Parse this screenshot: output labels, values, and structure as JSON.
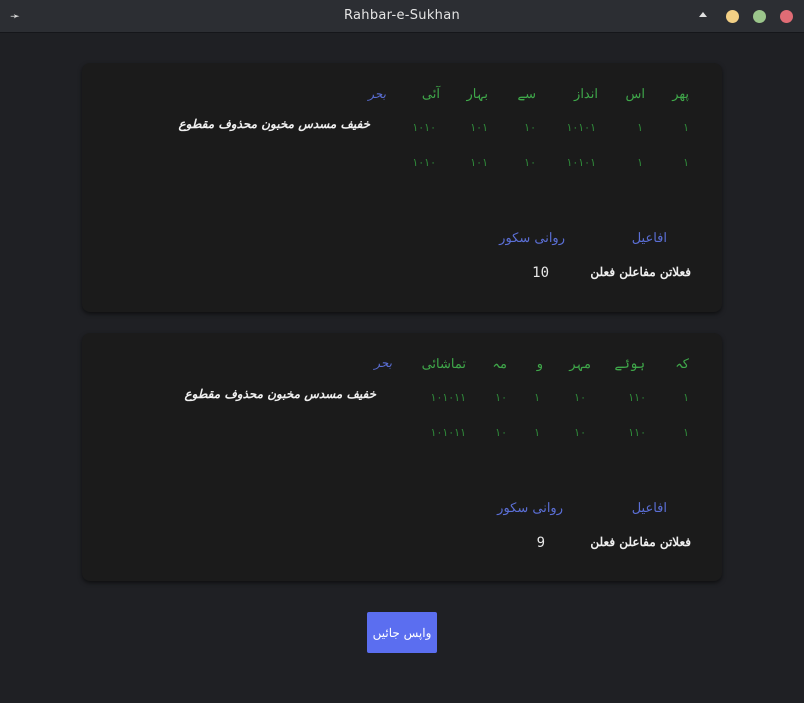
{
  "window": {
    "title": "Rahbar-e-Sukhan"
  },
  "results": [
    {
      "words": [
        "پھر",
        "اس",
        "انداز",
        "سے",
        "بہار",
        "آئی"
      ],
      "weights_row1": [
        "۱",
        "۱",
        "۱۰۱۰۱",
        "۱۰",
        "۱۰۱",
        "۱۰۱۰"
      ],
      "weights_row2": [
        "۱",
        "۱",
        "۱۰۱۰۱",
        "۱۰",
        "۱۰۱",
        "۱۰۱۰"
      ],
      "bahr_label": "بحر",
      "bahr_value": "خفیف مسدس مخبون محذوف مقطوع",
      "afaeel_label": "افاعیل",
      "afaeel_value": "فعلاتن مفاعلن فعلن",
      "score_label": "روانی سکور",
      "score_value": "10"
    },
    {
      "words": [
        "کہ",
        "ہوئے",
        "مہر",
        "و",
        "مہ",
        "تماشائی"
      ],
      "weights_row1": [
        "۱",
        "۱۱۰",
        "۱۰",
        "۱",
        "۱۰",
        "۱۰۱۰۱۱"
      ],
      "weights_row2": [
        "۱",
        "۱۱۰",
        "۱۰",
        "۱",
        "۱۰",
        "۱۰۱۰۱۱"
      ],
      "bahr_label": "بحر",
      "bahr_value": "خفیف مسدس مخبون محذوف مقطوع",
      "afaeel_label": "افاعیل",
      "afaeel_value": "فعلاتن مفاعلن فعلن",
      "score_label": "روانی سکور",
      "score_value": "9"
    }
  ],
  "back_button": {
    "label": "واپس جائیں"
  },
  "colors": {
    "background": "#1f2024",
    "card": "#1b1b1b",
    "word_green": "#3fa84a",
    "heading_blue": "#5b6fd6",
    "button_blue": "#5b6ef0"
  },
  "icons": {
    "app": "arrow-app-icon",
    "collapse": "chevron-up-icon"
  }
}
